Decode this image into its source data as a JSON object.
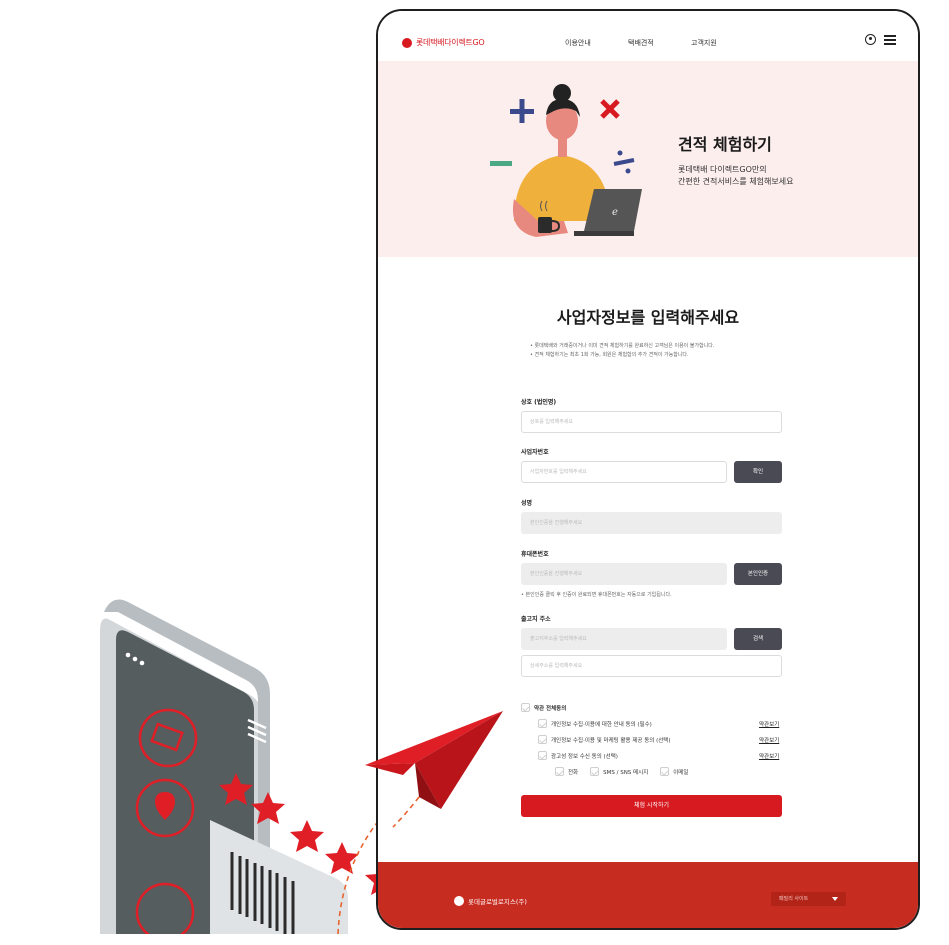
{
  "brand": {
    "logo_text": "롯데택배다이렉트GO",
    "accent": "#d71920",
    "footer_bg": "#c72c20"
  },
  "nav": {
    "items": [
      "이용안내",
      "택배견적",
      "고객지원"
    ],
    "icons": [
      "user-icon",
      "menu-icon"
    ]
  },
  "hero": {
    "title": "견적 체험하기",
    "subtitle_line1": "롯데택배 다이렉트GO만의",
    "subtitle_line2": "간편한 견적서비스를 체험해보세요"
  },
  "form": {
    "title": "사업자정보를 입력해주세요",
    "notice_line1": "• 롯데택배와 거래중이거나 이미 견적 체험하기를 완료하신 고객님은 이용이 불가합니다.",
    "notice_line2": "• 견적 체험하기는 최초 1회 가능, 회원은 체험함의 추가 견적이 가능합니다.",
    "company_label": "상호 (법인명)",
    "company_placeholder": "상호를 입력해주세요",
    "bizno_label": "사업자번호",
    "bizno_placeholder": "사업자번호를 입력해주세요",
    "confirm_button": "확인",
    "name_label": "성명",
    "name_placeholder": "본인인증을 진행해주세요",
    "phone_label": "휴대폰번호",
    "phone_placeholder": "본인인증을 진행해주세요",
    "auth_button": "본인인증",
    "phone_hint": "• 본인인증 클릭 후 인증이 완료되면 휴대폰번호는 자동으로 기입됩니다.",
    "address_label": "출고지 주소",
    "address_placeholder": "출고지주소를 입력해주세요",
    "search_button": "검색",
    "address_detail_placeholder": "상세주소를 입력해주세요"
  },
  "terms": {
    "all_agree": "약관 전체동의",
    "items": [
      {
        "label": "개인정보 수집·이용에 대한 안내 동의 (필수)",
        "link": "약관보기"
      },
      {
        "label": "개인정보 수집·이용 및 마케팅 활용 제공 동의 (선택)",
        "link": "약관보기"
      },
      {
        "label": "광고성 정보 수신 동의 (선택)",
        "link": "약관보기"
      }
    ],
    "channels": [
      "전화",
      "SMS / SNS 메시지",
      "이메일"
    ]
  },
  "submit_button": "체험 시작하기",
  "footer": {
    "company": "롯데글로벌로지스(주)",
    "family_site": "패밀리 사이트"
  }
}
